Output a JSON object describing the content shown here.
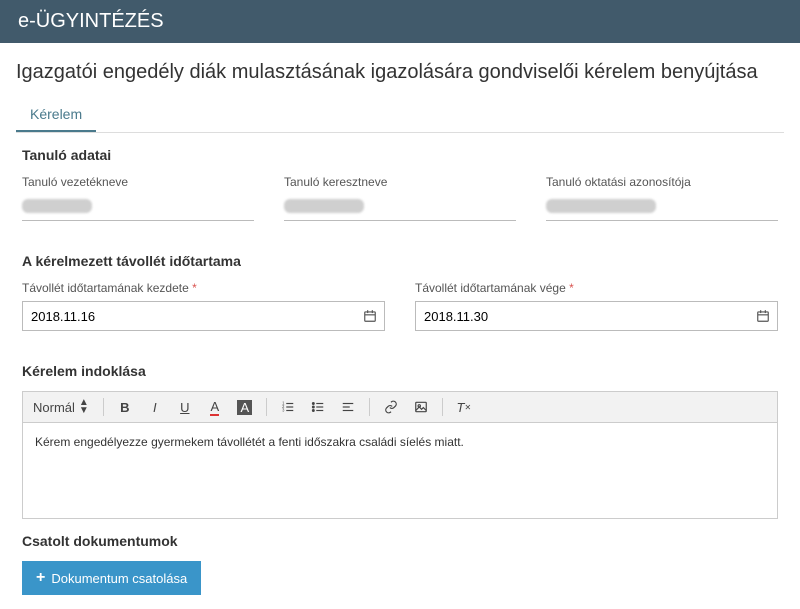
{
  "header": {
    "app_title": "e-ÜGYINTÉZÉS"
  },
  "page_title": "Igazgatói engedély diák mulasztásának igazolására gondviselői kérelem benyújtása",
  "tabs": [
    {
      "label": "Kérelem"
    }
  ],
  "student_section": {
    "title": "Tanuló adatai",
    "lastname_label": "Tanuló vezetékneve",
    "firstname_label": "Tanuló keresztneve",
    "eduid_label": "Tanuló oktatási azonosítója"
  },
  "absence_section": {
    "title": "A kérelmezett távollét időtartama",
    "start_label": "Távollét időtartamának kezdete",
    "end_label": "Távollét időtartamának vége",
    "start_value": "2018.11.16",
    "end_value": "2018.11.30"
  },
  "reason_section": {
    "title": "Kérelem indoklása",
    "format_label": "Normál",
    "body": "Kérem engedélyezze gyermekem távollétét a fenti időszakra családi síelés miatt."
  },
  "attach_section": {
    "title": "Csatolt dokumentumok",
    "button_label": "Dokumentum csatolása"
  }
}
